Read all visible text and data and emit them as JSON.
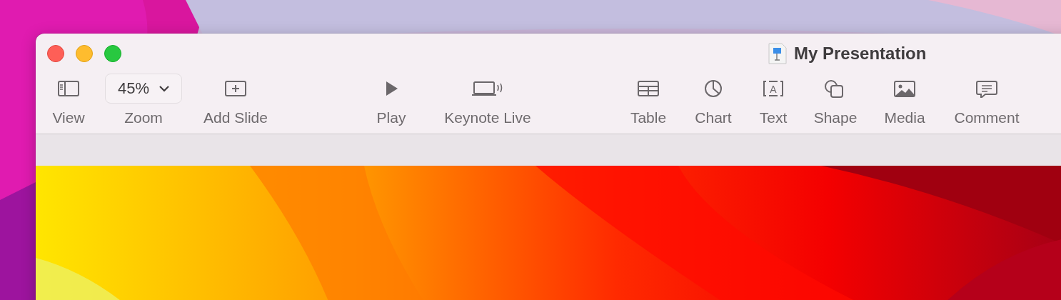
{
  "window": {
    "title": "My Presentation"
  },
  "toolbar": [
    {
      "kind": "button",
      "label": "View"
    },
    {
      "kind": "dropdown",
      "label": "Zoom",
      "value": "45%"
    },
    {
      "kind": "button",
      "label": "Add Slide"
    },
    {
      "kind": "button",
      "label": "Play"
    },
    {
      "kind": "button",
      "label": "Keynote Live"
    },
    {
      "kind": "button",
      "label": "Table"
    },
    {
      "kind": "button",
      "label": "Chart"
    },
    {
      "kind": "button",
      "label": "Text",
      "icon_text": "A"
    },
    {
      "kind": "button",
      "label": "Shape"
    },
    {
      "kind": "button",
      "label": "Media"
    },
    {
      "kind": "button",
      "label": "Comment"
    }
  ]
}
